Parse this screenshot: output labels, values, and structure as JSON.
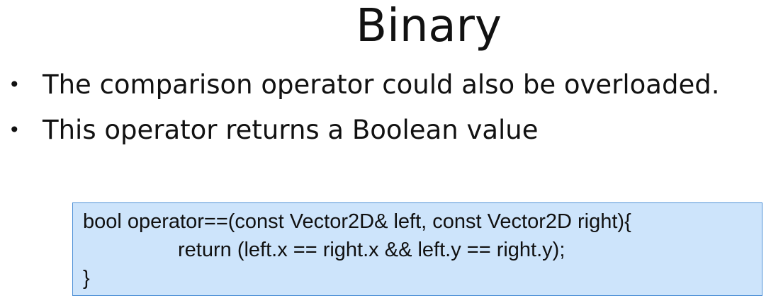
{
  "slide": {
    "title": "Binary",
    "bullets": [
      "The comparison operator could also be overloaded.",
      "This operator returns a Boolean value"
    ],
    "code_lines": [
      "bool operator==(const Vector2D& left, const Vector2D right){",
      "return (left.x == right.x && left.y == right.y);",
      "}"
    ],
    "bullet_glyph": "•"
  },
  "colors": {
    "code_background": "#cde4fb",
    "code_border": "#4c8fd6",
    "text": "#111111"
  }
}
